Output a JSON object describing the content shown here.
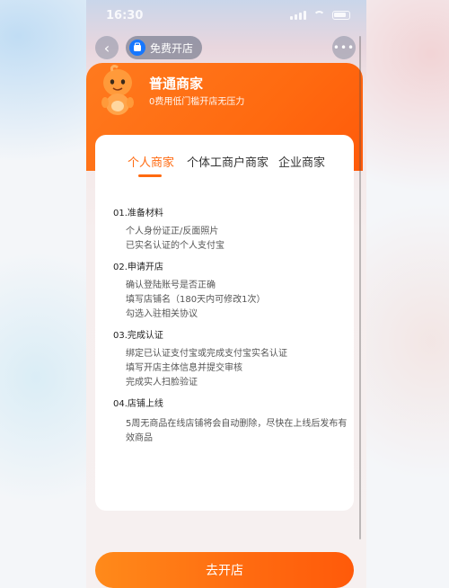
{
  "status_bar": {
    "time": "16:30"
  },
  "nav": {
    "title": "免费开店"
  },
  "hero": {
    "title": "普通商家",
    "subtitle": "0费用低门槛开店无压力"
  },
  "tabs": [
    {
      "label": "个人商家",
      "active": true
    },
    {
      "label": "个体工商户商家",
      "active": false
    },
    {
      "label": "企业商家",
      "active": false
    }
  ],
  "sections": [
    {
      "title": "01.准备材料",
      "items": [
        "个人身份证正/反面照片",
        "已实名认证的个人支付宝"
      ]
    },
    {
      "title": "02.申请开店",
      "items": [
        "确认登陆账号是否正确",
        "填写店铺名（180天内可修改1次）",
        "勾选入驻相关协议"
      ]
    },
    {
      "title": "03.完成认证",
      "items": [
        "绑定已认证支付宝或完成支付宝实名认证",
        "填写开店主体信息并提交审核",
        "完成实人扫脸验证"
      ]
    },
    {
      "title": "04.店铺上线",
      "items": [
        "5周无商品在线店铺将会自动删除，尽快在上线后发布有",
        "效商品"
      ]
    }
  ],
  "cta": {
    "label": "去开店"
  },
  "colors": {
    "accent": "#ff6a10",
    "brand_blue": "#1677ff"
  },
  "icons": {
    "back": "chevron-left-icon",
    "app": "taobao-icon",
    "more": "more-dots-icon",
    "mascot": "mascot-icon"
  }
}
